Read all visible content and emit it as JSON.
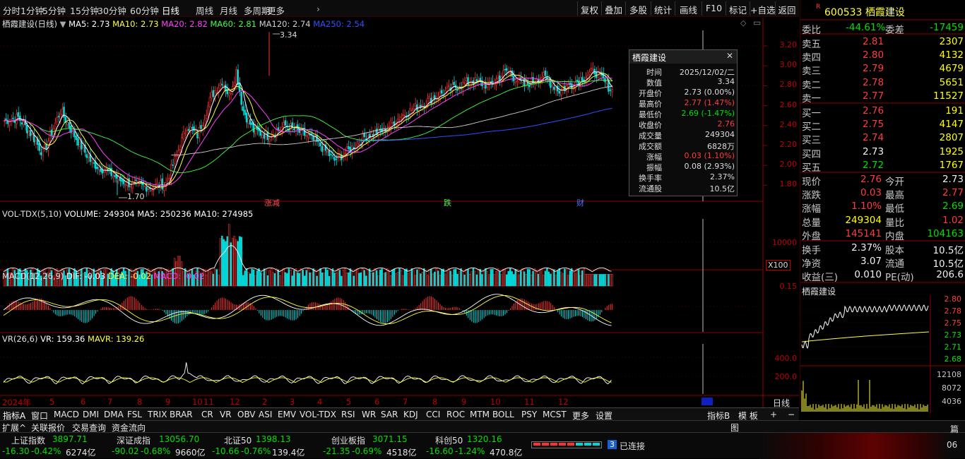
{
  "toolbar": {
    "periods": [
      "分时",
      "1分钟",
      "5分钟",
      "15分钟",
      "30分钟",
      "60分钟",
      "日线",
      "周线",
      "月线",
      "多周期",
      "更多"
    ],
    "active_period": "日线",
    "right_buttons": [
      "复权",
      "叠加",
      "多股",
      "统计",
      "画线",
      "F10",
      "标记",
      "+自选",
      "返回"
    ]
  },
  "chart_header": {
    "title": "栖霞建设(日线)",
    "ma5": "MA5: 2.73",
    "ma10": "MA10: 2.73",
    "ma20": "MA20: 2.82",
    "ma60": "MA60: 2.81",
    "ma120": "MA120: 2.74",
    "ma250": "MA250: 2.54",
    "high_mark": "3.34",
    "low_mark": "1.70",
    "event_labels": [
      "涨减",
      "跌",
      "财"
    ]
  },
  "price_axis": [
    "3.20",
    "3.00",
    "2.80",
    "2.60",
    "2.40",
    "2.20",
    "2.00",
    "1.80"
  ],
  "volume_header": {
    "name": "VOL-TDX(5,10)",
    "volume": "VOLUME: 249304",
    "ma5": "MA5: 250236",
    "ma10": "MA10: 274985"
  },
  "volume_axis": {
    "tick": "10000",
    "unit": "X100"
  },
  "macd_header": {
    "name": "MACD(12,26,9)",
    "dif": "DIF: -0.03",
    "dea": "DEA: -0.02",
    "macd": "MACD: -0.02"
  },
  "macd_axis": {
    "tick": "0.15"
  },
  "vr_header": {
    "name": "VR(26,6)",
    "vr": "VR: 159.36",
    "mavr": "MAVR: 139.26"
  },
  "vr_axis": [
    "400.0",
    "200.0"
  ],
  "time_axis": {
    "year": "2024年",
    "months": [
      "5",
      "6",
      "7",
      "8",
      "9",
      "10",
      "11",
      "12",
      "2",
      "3",
      "4",
      "5",
      "6",
      "7",
      "8",
      "9",
      "10",
      "11",
      "12"
    ],
    "period_label": "日线"
  },
  "popup": {
    "title": "栖霞建设",
    "rows": [
      {
        "k": "时间",
        "v": "2025/12/02/二",
        "c": "white"
      },
      {
        "k": "数值",
        "v": "3.34",
        "c": "white"
      },
      {
        "k": "开盘价",
        "v": "2.73 (0.00%)",
        "c": "white"
      },
      {
        "k": "最高价",
        "v": "2.77 (1.47%)",
        "c": "red"
      },
      {
        "k": "最低价",
        "v": "2.69 (-1.47%)",
        "c": "green"
      },
      {
        "k": "收盘价",
        "v": "2.76",
        "c": "red"
      },
      {
        "k": "成交量",
        "v": "249304",
        "c": "white"
      },
      {
        "k": "成交额",
        "v": "6828万",
        "c": "white"
      },
      {
        "k": "涨幅",
        "v": "0.03 (1.10%)",
        "c": "red"
      },
      {
        "k": "振幅",
        "v": "0.08 (2.93%)",
        "c": "white"
      },
      {
        "k": "换手率",
        "v": "2.37%",
        "c": "white"
      },
      {
        "k": "流通股",
        "v": "10.5亿",
        "c": "white"
      }
    ]
  },
  "quote": {
    "code": "600533",
    "name": "栖霞建设",
    "weibi_label": "委比",
    "weibi": "-44.61%",
    "weicha_label": "委差",
    "weicha": "-17459",
    "sell": [
      {
        "label": "卖五",
        "price": "2.81",
        "vol": "2307",
        "pc": "red"
      },
      {
        "label": "卖四",
        "price": "2.80",
        "vol": "4132",
        "pc": "red"
      },
      {
        "label": "卖三",
        "price": "2.79",
        "vol": "4679",
        "pc": "red"
      },
      {
        "label": "卖二",
        "price": "2.78",
        "vol": "5651",
        "pc": "red"
      },
      {
        "label": "卖一",
        "price": "2.77",
        "vol": "11527",
        "pc": "red"
      }
    ],
    "buy": [
      {
        "label": "买一",
        "price": "2.76",
        "vol": "191",
        "pc": "red"
      },
      {
        "label": "买二",
        "price": "2.75",
        "vol": "4147",
        "pc": "red"
      },
      {
        "label": "买三",
        "price": "2.74",
        "vol": "2807",
        "pc": "red"
      },
      {
        "label": "买四",
        "price": "2.73",
        "vol": "1925",
        "pc": "white"
      },
      {
        "label": "买五",
        "price": "2.72",
        "vol": "1767",
        "pc": "green"
      }
    ],
    "stats1": [
      {
        "l1": "现价",
        "v1": "2.76",
        "c1": "red",
        "l2": "今开",
        "v2": "2.73",
        "c2": "white"
      },
      {
        "l1": "涨跌",
        "v1": "0.03",
        "c1": "red",
        "l2": "最高",
        "v2": "2.77",
        "c2": "red"
      },
      {
        "l1": "涨幅",
        "v1": "1.10%",
        "c1": "red",
        "l2": "最低",
        "v2": "2.69",
        "c2": "green"
      },
      {
        "l1": "总量",
        "v1": "249304",
        "c1": "yellow",
        "l2": "量比",
        "v2": "1.02",
        "c2": "red"
      },
      {
        "l1": "外盘",
        "v1": "145141",
        "c1": "red",
        "l2": "内盘",
        "v2": "104163",
        "c2": "green"
      }
    ],
    "stats2": [
      {
        "l1": "换手",
        "v1": "2.37%",
        "l2": "股本",
        "v2": "10.5亿"
      },
      {
        "l1": "净资",
        "v1": "3.07",
        "l2": "流通",
        "v2": "10.5亿"
      },
      {
        "l1": "收益(三)",
        "v1": "0.010",
        "l2": "PE(动)",
        "v2": "206.6"
      }
    ],
    "mini_title": "栖霞建设",
    "mini_axis": [
      "2.80",
      "2.78",
      "2.75",
      "2.73",
      "2.71",
      "2.68"
    ],
    "mini_vol_axis": [
      "12108",
      "8072",
      "4036"
    ]
  },
  "bottom_tabs": [
    "指标A",
    "窗口",
    "MACD",
    "DMI",
    "DMA",
    "FSL",
    "TRIX",
    "BRAR",
    "CR",
    "VR",
    "OBV",
    "ASI",
    "EMV",
    "VOL-TDX",
    "RSI",
    "WR",
    "SAR",
    "KDJ",
    "CCI",
    "ROC",
    "MTM",
    "BOLL",
    "PSY",
    "MCST",
    "更多",
    "设置"
  ],
  "bottom_right_tabs": [
    "指标B",
    "模 板",
    "+",
    "−"
  ],
  "tabs2": [
    "扩展^",
    "关联报价",
    "交易查询",
    "资金流向"
  ],
  "tabs2_right": "图",
  "indices": [
    {
      "name": "上证指数",
      "value": "3897.71",
      "chg": "-16.30",
      "pct": "-0.42%",
      "amt": "6274亿"
    },
    {
      "name": "深证成指",
      "value": "13056.70",
      "chg": "-90.02",
      "pct": "-0.68%",
      "amt": "9660亿"
    },
    {
      "name": "北证50",
      "value": "1398.13",
      "chg": "-10.66",
      "pct": "-0.76%",
      "amt": "139.4亿"
    },
    {
      "name": "创业板指",
      "value": "3071.15",
      "chg": "-21.35",
      "pct": "-0.69%",
      "amt": "4518亿"
    },
    {
      "name": "科创50",
      "value": "1320.16",
      "chg": "-16.60",
      "pct": "-1.24%",
      "amt": "470.8亿"
    }
  ],
  "connection": {
    "count": "3",
    "label": "已连接"
  },
  "right_edge_text": "篇",
  "right_edge_time": "06"
}
